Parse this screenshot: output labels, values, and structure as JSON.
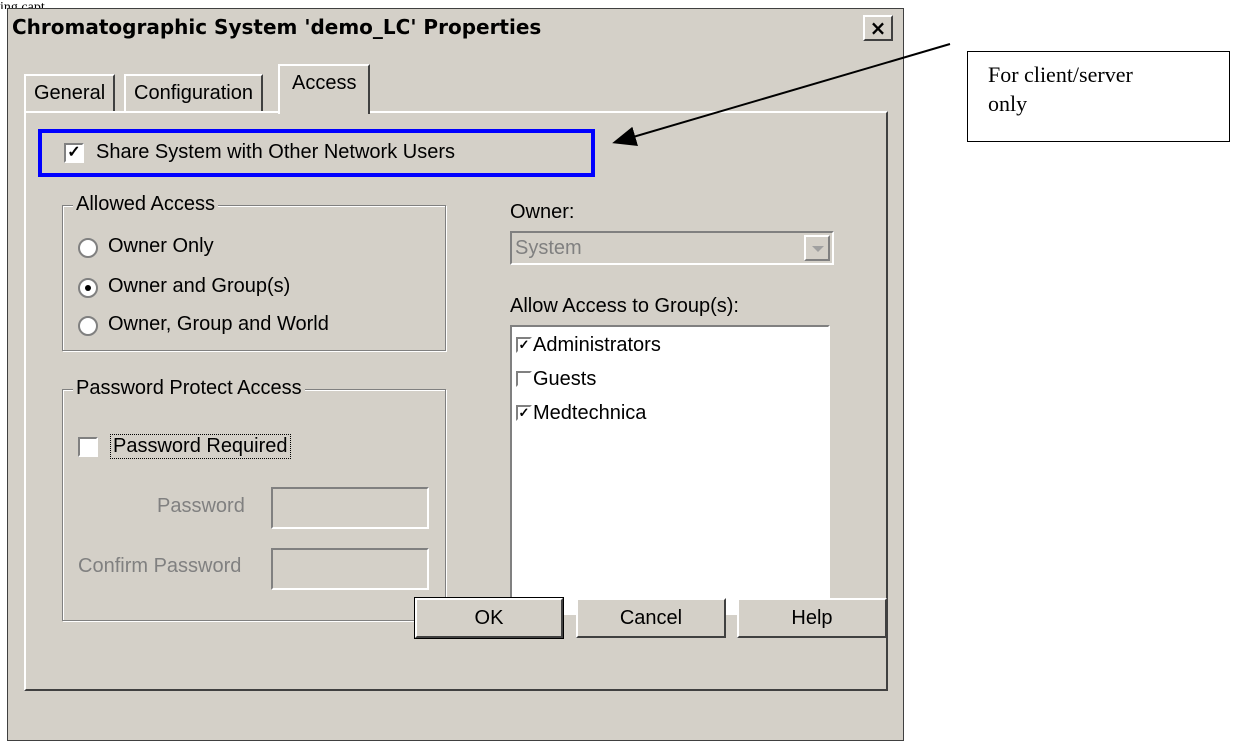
{
  "header_fragment": "ing capt",
  "dialog": {
    "title": "Chromatographic System 'demo_LC' Properties",
    "close_label": "×",
    "tabs": [
      {
        "label": "General"
      },
      {
        "label": "Configuration"
      },
      {
        "label": "Access",
        "active": true
      }
    ],
    "share": {
      "label": "Share System with Other Network Users",
      "checked": true
    },
    "allowed_access": {
      "title": "Allowed Access",
      "options": [
        {
          "label": "Owner Only",
          "selected": false
        },
        {
          "label": "Owner and Group(s)",
          "selected": true
        },
        {
          "label": "Owner, Group and World",
          "selected": false
        }
      ]
    },
    "owner": {
      "label": "Owner:",
      "value": "System"
    },
    "groups": {
      "label": "Allow Access to Group(s):",
      "items": [
        {
          "label": "Administrators",
          "checked": true
        },
        {
          "label": "Guests",
          "checked": false
        },
        {
          "label": "Medtechnica",
          "checked": true
        }
      ]
    },
    "password": {
      "title": "Password Protect Access",
      "required_label": "Password Required",
      "required_checked": false,
      "password_label": "Password",
      "confirm_label": "Confirm Password"
    },
    "buttons": {
      "ok": "OK",
      "cancel": "Cancel",
      "help": "Help"
    }
  },
  "callout": {
    "text_line1": "For client/server",
    "text_line2": "only"
  },
  "colors": {
    "highlight_border": "#0000ff",
    "dialog_bg": "#d4d0c8"
  }
}
